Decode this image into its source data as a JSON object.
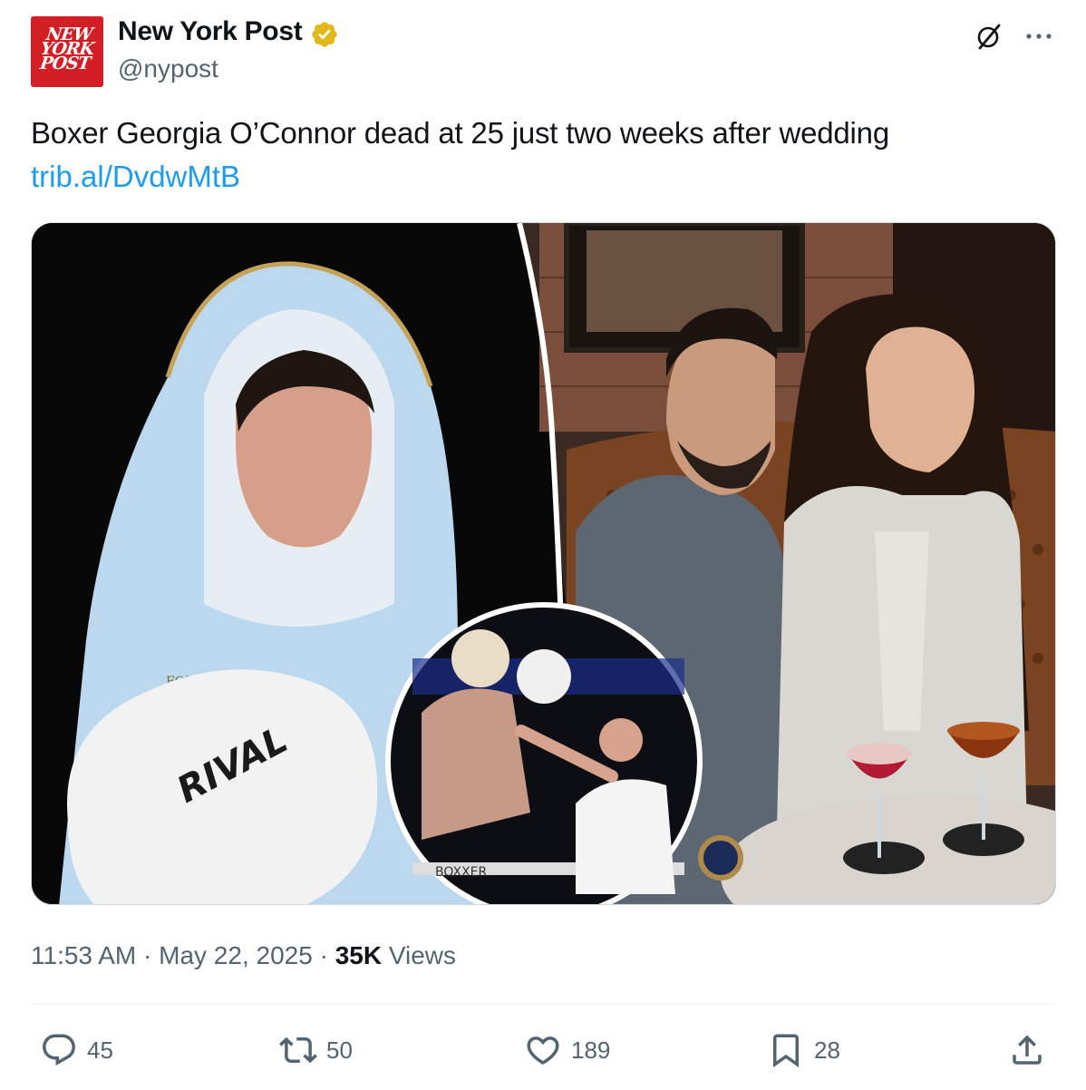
{
  "account": {
    "avatar_text": [
      "NEW",
      "YORK",
      "POST"
    ],
    "display_name": "New York Post",
    "handle": "@nypost",
    "verified_badge": "gold-verified-badge"
  },
  "tweet": {
    "text": "Boxer Georgia O’Connor dead at 25 just two weeks after wedding",
    "link": "trib.al/DvdwMtB"
  },
  "media": {
    "glove_text": "RIVAL",
    "sponsor_text": "FORTIS",
    "ring_banner": "BOXXER"
  },
  "meta": {
    "time": "11:53 AM",
    "separator": "·",
    "date": "May 22, 2025",
    "views_count": "35K",
    "views_label": "Views"
  },
  "actions": {
    "replies": "45",
    "reposts": "50",
    "likes": "189",
    "bookmarks": "28"
  },
  "colors": {
    "link": "#1d9bf0",
    "secondary_text": "#536471",
    "brand_red": "#d31e25",
    "verified_gold": "#e2b719"
  }
}
